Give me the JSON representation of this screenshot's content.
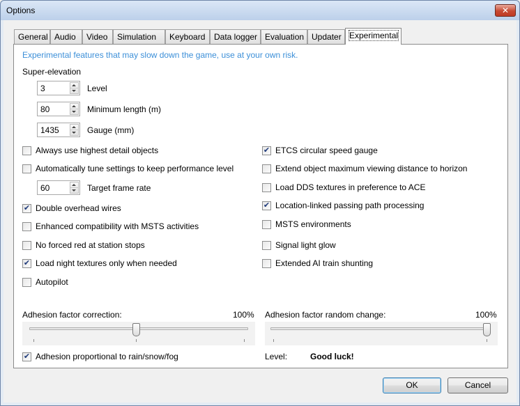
{
  "window": {
    "title": "Options",
    "close_label": "✕"
  },
  "tabs": [
    {
      "label": "General"
    },
    {
      "label": "Audio"
    },
    {
      "label": "Video"
    },
    {
      "label": "Simulation"
    },
    {
      "label": "Keyboard"
    },
    {
      "label": "Data logger"
    },
    {
      "label": "Evaluation"
    },
    {
      "label": "Updater"
    },
    {
      "label": "Experimental",
      "active": true
    }
  ],
  "experimental": {
    "info": "Experimental features that may slow down the game, use at your own risk.",
    "superelevation_title": "Super-elevation",
    "level": {
      "value": "3",
      "label": "Level"
    },
    "min_length": {
      "value": "80",
      "label": "Minimum length (m)"
    },
    "gauge": {
      "value": "1435",
      "label": "Gauge (mm)"
    },
    "target_frame_rate": {
      "value": "60",
      "label": "Target frame rate"
    },
    "left_checks": [
      {
        "label": "Always use highest detail objects",
        "checked": false
      },
      {
        "label": "Automatically tune settings to keep performance level",
        "checked": false
      },
      {
        "label": "Double overhead wires",
        "checked": true
      },
      {
        "label": "Enhanced compatibility with MSTS activities",
        "checked": false
      },
      {
        "label": "No forced red at station stops",
        "checked": false
      },
      {
        "label": "Load night textures only when needed",
        "checked": true
      },
      {
        "label": "Autopilot",
        "checked": false
      }
    ],
    "right_checks": [
      {
        "label": "ETCS circular speed gauge",
        "checked": true
      },
      {
        "label": "Extend object maximum viewing distance to horizon",
        "checked": false
      },
      {
        "label": "Load DDS textures in preference to ACE",
        "checked": false
      },
      {
        "label": "Location-linked passing path processing",
        "checked": true
      },
      {
        "label": "MSTS environments",
        "checked": false
      },
      {
        "label": "Signal light glow",
        "checked": false
      },
      {
        "label": "Extended AI train shunting",
        "checked": false
      }
    ],
    "adhesion_correction": {
      "label": "Adhesion factor correction:",
      "value_text": "100%",
      "fraction": 0.49
    },
    "adhesion_random": {
      "label": "Adhesion factor random change:",
      "value_text": "100%",
      "fraction": 1.0
    },
    "adhesion_weather": {
      "label": "Adhesion proportional to rain/snow/fog",
      "checked": true
    },
    "level_label": "Level:",
    "level_value": "Good luck!"
  },
  "buttons": {
    "ok": "OK",
    "cancel": "Cancel"
  },
  "check_glyph": "✔"
}
